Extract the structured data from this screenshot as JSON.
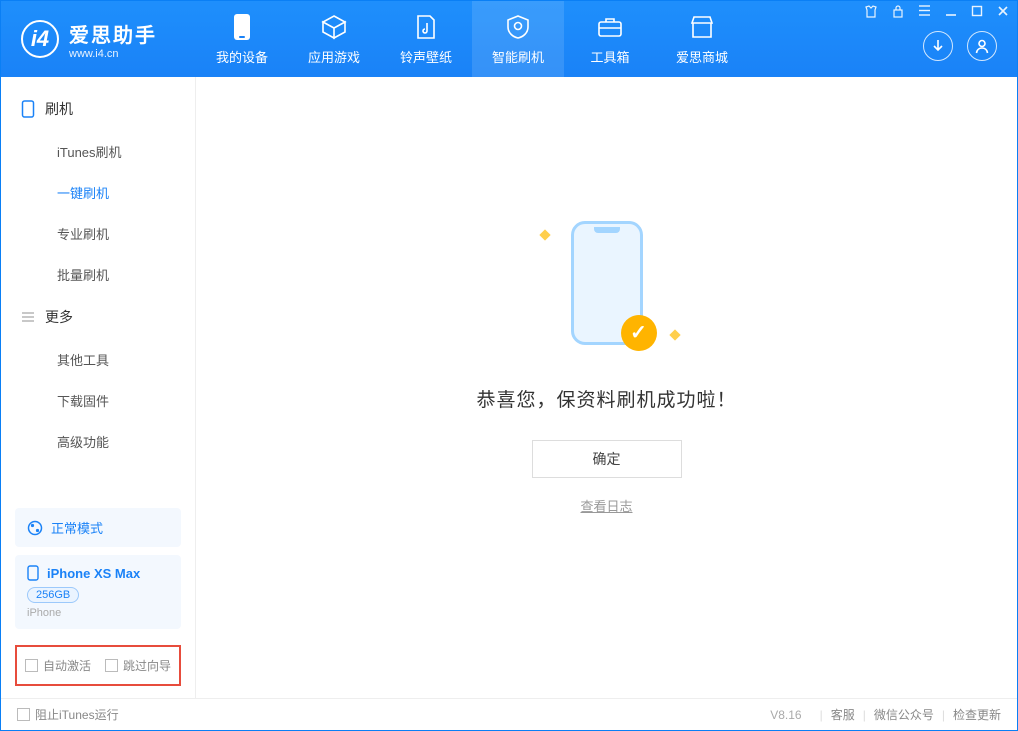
{
  "app": {
    "title": "爱思助手",
    "url": "www.i4.cn"
  },
  "nav": {
    "tabs": [
      {
        "label": "我的设备",
        "icon": "device"
      },
      {
        "label": "应用游戏",
        "icon": "cube"
      },
      {
        "label": "铃声壁纸",
        "icon": "music"
      },
      {
        "label": "智能刷机",
        "icon": "gear"
      },
      {
        "label": "工具箱",
        "icon": "toolbox"
      },
      {
        "label": "爱思商城",
        "icon": "store"
      }
    ],
    "activeIndex": 3
  },
  "sidebar": {
    "groups": [
      {
        "title": "刷机",
        "icon": "phone",
        "items": [
          {
            "label": "iTunes刷机"
          },
          {
            "label": "一键刷机",
            "active": true
          },
          {
            "label": "专业刷机"
          },
          {
            "label": "批量刷机"
          }
        ]
      },
      {
        "title": "更多",
        "icon": "menu",
        "items": [
          {
            "label": "其他工具"
          },
          {
            "label": "下载固件"
          },
          {
            "label": "高级功能"
          }
        ]
      }
    ],
    "mode": {
      "label": "正常模式"
    },
    "device": {
      "name": "iPhone XS Max",
      "storage": "256GB",
      "type": "iPhone"
    },
    "options": {
      "autoActivate": "自动激活",
      "skipGuide": "跳过向导"
    }
  },
  "main": {
    "successTitle": "恭喜您，保资料刷机成功啦！",
    "okButton": "确定",
    "logLink": "查看日志"
  },
  "statusbar": {
    "blockItunes": "阻止iTunes运行",
    "version": "V8.16",
    "links": [
      "客服",
      "微信公众号",
      "检查更新"
    ]
  }
}
